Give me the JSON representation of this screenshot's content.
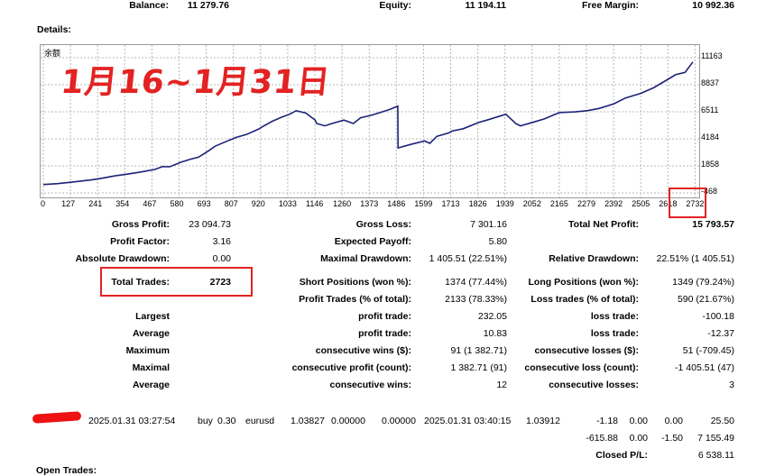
{
  "summary": {
    "balance_label": "Balance:",
    "balance_value": "11 279.76",
    "equity_label": "Equity:",
    "equity_value": "11 194.11",
    "free_margin_label": "Free Margin:",
    "free_margin_value": "10 992.36"
  },
  "details_label": "Details:",
  "chart_data": {
    "type": "line",
    "title": "余额",
    "annotation": "1月16~1月31日",
    "x_ticks": [
      "0",
      "127",
      "241",
      "354",
      "467",
      "580",
      "693",
      "807",
      "920",
      "1033",
      "1146",
      "1260",
      "1373",
      "1486",
      "1599",
      "1713",
      "1826",
      "1939",
      "2052",
      "2165",
      "2279",
      "2392",
      "2505",
      "2618",
      "2732"
    ],
    "y_ticks": [
      "11163",
      "8837",
      "6511",
      "4184",
      "1858",
      "-468"
    ],
    "xlim": [
      0,
      2723
    ],
    "ylim": [
      -468,
      11163
    ],
    "grid": true,
    "series": [
      {
        "color": "#1c2277",
        "x": [
          0,
          60,
          127,
          200,
          241,
          300,
          354,
          400,
          467,
          500,
          530,
          580,
          620,
          650,
          693,
          720,
          760,
          807,
          850,
          900,
          920,
          960,
          1000,
          1033,
          1060,
          1100,
          1140,
          1146,
          1180,
          1210,
          1260,
          1300,
          1330,
          1373,
          1420,
          1450,
          1486,
          1487,
          1540,
          1599,
          1620,
          1650,
          1700,
          1713,
          1760,
          1826,
          1860,
          1939,
          1980,
          2000,
          2052,
          2100,
          2140,
          2165,
          2230,
          2279,
          2330,
          2392,
          2440,
          2505,
          2560,
          2618,
          2650,
          2690,
          2723
        ],
        "y": [
          250,
          330,
          480,
          650,
          780,
          1000,
          1150,
          1300,
          1550,
          1800,
          1780,
          2200,
          2450,
          2600,
          3150,
          3550,
          3900,
          4300,
          4550,
          5000,
          5250,
          5700,
          6050,
          6300,
          6600,
          6400,
          5800,
          5500,
          5300,
          5500,
          5800,
          5500,
          6000,
          6200,
          6500,
          6700,
          7000,
          3400,
          3700,
          4000,
          3800,
          4400,
          4700,
          4850,
          5050,
          5600,
          5800,
          6300,
          5500,
          5300,
          5600,
          5900,
          6250,
          6450,
          6500,
          6600,
          6800,
          7200,
          7700,
          8100,
          8600,
          9300,
          9700,
          9900,
          10800
        ]
      }
    ]
  },
  "stats": {
    "gross_profit_label": "Gross Profit:",
    "gross_profit_value": "23 094.73",
    "gross_loss_label": "Gross Loss:",
    "gross_loss_value": "7 301.16",
    "total_net_profit_label": "Total Net Profit:",
    "total_net_profit_value": "15 793.57",
    "profit_factor_label": "Profit Factor:",
    "profit_factor_value": "3.16",
    "expected_payoff_label": "Expected Payoff:",
    "expected_payoff_value": "5.80",
    "absolute_drawdown_label": "Absolute Drawdown:",
    "absolute_drawdown_value": "0.00",
    "maximal_drawdown_label": "Maximal Drawdown:",
    "maximal_drawdown_value": "1 405.51 (22.51%)",
    "relative_drawdown_label": "Relative Drawdown:",
    "relative_drawdown_value": "22.51% (1 405.51)",
    "total_trades_label": "Total Trades:",
    "total_trades_value": "2723",
    "short_positions_label": "Short Positions (won %):",
    "short_positions_value": "1374 (77.44%)",
    "long_positions_label": "Long Positions (won %):",
    "long_positions_value": "1349 (79.24%)",
    "profit_trades_label": "Profit Trades (% of total):",
    "profit_trades_value": "2133 (78.33%)",
    "loss_trades_label": "Loss trades (% of total):",
    "loss_trades_value": "590 (21.67%)",
    "largest_label": "Largest",
    "largest_profit_label": "profit trade:",
    "largest_profit_value": "232.05",
    "largest_loss_label": "loss trade:",
    "largest_loss_value": "-100.18",
    "average_label": "Average",
    "average_profit_label": "profit trade:",
    "average_profit_value": "10.83",
    "average_loss_label": "loss trade:",
    "average_loss_value": "-12.37",
    "maximum_label": "Maximum",
    "max_cons_wins_label": "consecutive wins ($):",
    "max_cons_wins_value": "91 (1 382.71)",
    "max_cons_losses_label": "consecutive losses ($):",
    "max_cons_losses_value": "51 (-709.45)",
    "maximal_label": "Maximal",
    "maximal_cons_profit_label": "consecutive profit (count):",
    "maximal_cons_profit_value": "1 382.71 (91)",
    "maximal_cons_loss_label": "consecutive loss (count):",
    "maximal_cons_loss_value": "-1 405.51 (47)",
    "average2_label": "Average",
    "avg_cons_wins_label": "consecutive wins:",
    "avg_cons_wins_value": "12",
    "avg_cons_losses_label": "consecutive losses:",
    "avg_cons_losses_value": "3"
  },
  "trade_row": {
    "open_time": "2025.01.31 03:27:54",
    "type": "buy",
    "volume": "0.30",
    "symbol": "eurusd",
    "open_price": "1.03827",
    "sl": "0.00000",
    "tp": "0.00000",
    "close_time": "2025.01.31 03:40:15",
    "close_price": "1.03912",
    "commission": "-1.18",
    "taxes": "0.00",
    "swap": "0.00",
    "profit": "25.50"
  },
  "totals_row": {
    "commission": "-615.88",
    "taxes": "0.00",
    "swap": "-1.50",
    "profit": "7 155.49"
  },
  "closed_pl": {
    "label": "Closed P/L:",
    "value": "6 538.11"
  },
  "open_trades_label": "Open Trades:"
}
